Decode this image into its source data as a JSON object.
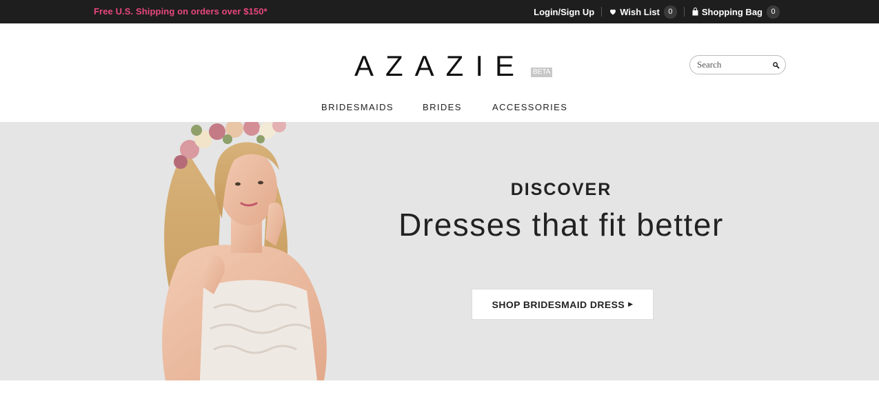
{
  "topbar": {
    "promo": "Free U.S. Shipping on orders over $150*",
    "login_label": "Login/Sign Up",
    "wishlist_label": "Wish List",
    "wishlist_count": "0",
    "bag_label": "Shopping Bag",
    "bag_count": "0",
    "promo_color": "#e8477c"
  },
  "header": {
    "logo": "AZAZIE",
    "beta_badge": "BETA",
    "search_placeholder": "Search"
  },
  "nav": {
    "items": [
      {
        "label": "BRIDESMAIDS"
      },
      {
        "label": "BRIDES"
      },
      {
        "label": "ACCESSORIES"
      }
    ]
  },
  "hero": {
    "kicker": "DISCOVER",
    "headline": "Dresses that fit better",
    "cta_label": "SHOP BRIDESMAID DRESS",
    "cta_arrow": "▶",
    "background": "#e5e5e5"
  },
  "icons": [
    "heart-icon",
    "shopping-bag-icon",
    "search-icon"
  ]
}
